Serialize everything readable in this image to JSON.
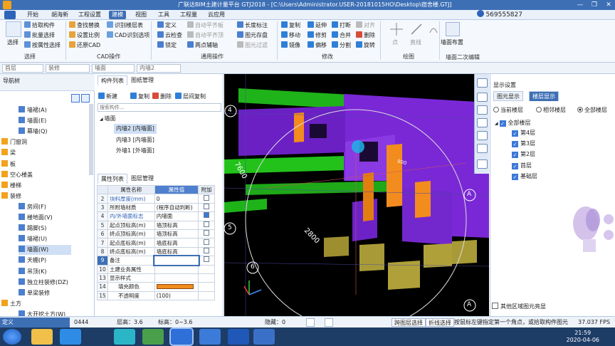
{
  "titlebar": {
    "title": "广联达BIM土建计量平台 GTJ2018 - [C:\\Users\\Administrator.USER-20181015HO\\Desktop\\宿舍楼.GTJ]"
  },
  "menubar": {
    "items": [
      "开始",
      "胡海新",
      "工程设置",
      "建模",
      "视图",
      "工具",
      "工程量",
      "云应用"
    ],
    "active": "建模",
    "user_id": "569555827"
  },
  "ribbon": {
    "select_label": "选择",
    "pick_component": "拾取构件",
    "batch_select": "批量选择",
    "select_by_attr": "按属性选择",
    "group_select": "选择",
    "find_replace": "查找替换",
    "set_scale": "设置比例",
    "restore_cad": "还原CAD",
    "identify_floor_table": "识别楼层表",
    "cad_identify_options": "CAD识别选项",
    "group_cad": "CAD操作",
    "define": "定义",
    "cloud_check": "云检查",
    "lock": "锁定",
    "auto_plane_slab": "自动平齐板",
    "auto_plane_top": "自动平齐顶",
    "two_point_axis": "两点辅轴",
    "find_element": "查找图元",
    "filter_element": "过滤图元",
    "length_mark": "长度标注",
    "element_save": "图元存盘",
    "element_filter": "图元过滤",
    "group_common": "通用操作",
    "copy": "复制",
    "move": "移动",
    "mirror": "镜像",
    "extend": "延伸",
    "trim": "修剪",
    "offset": "偏移",
    "break": "打断",
    "merge": "合并",
    "split": "分割",
    "delete": "删除",
    "rotate": "旋转",
    "align": "对齐",
    "group_modify": "修改",
    "draw_point": "点",
    "draw_line": "直线",
    "draw_arc": "",
    "group_draw": "绘图",
    "wall_layout": "墙面布置",
    "group_identify": "墙面二次编辑"
  },
  "selectors": {
    "floor": "首层",
    "type": "装修",
    "category": "墙面",
    "component": "内墙2"
  },
  "nav": {
    "title": "导航树",
    "items": [
      {
        "label": "墙裙(A)",
        "indent": 2
      },
      {
        "label": "墙面(E)",
        "indent": 2
      },
      {
        "label": "幕墙(Q)",
        "indent": 2
      },
      {
        "label": "门窗洞",
        "indent": 1
      },
      {
        "label": "梁",
        "indent": 1
      },
      {
        "label": "板",
        "indent": 1
      },
      {
        "label": "空心楼盖",
        "indent": 1
      },
      {
        "label": "楼梯",
        "indent": 1
      },
      {
        "label": "装修",
        "indent": 1
      },
      {
        "label": "房间(F)",
        "indent": 2
      },
      {
        "label": "楼地面(V)",
        "indent": 2
      },
      {
        "label": "踢脚(S)",
        "indent": 2
      },
      {
        "label": "墙裙(U)",
        "indent": 2
      },
      {
        "label": "墙面(W)",
        "indent": 2,
        "selected": true
      },
      {
        "label": "天棚(P)",
        "indent": 2
      },
      {
        "label": "吊顶(K)",
        "indent": 2
      },
      {
        "label": "独立柱装修(DZ)",
        "indent": 2
      },
      {
        "label": "单梁装修",
        "indent": 2
      },
      {
        "label": "土方",
        "indent": 1
      },
      {
        "label": "大开挖土方(W)",
        "indent": 2
      }
    ]
  },
  "components": {
    "tab1": "构件列表",
    "tab2": "图纸管理",
    "new_btn": "新建",
    "copy_btn": "复制",
    "delete_btn": "删除",
    "floor_copy_btn": "层间复制",
    "search_placeholder": "搜索构件...",
    "group": "墙面",
    "items": [
      "内墙2 [内墙面]",
      "内墙3 [内墙面]",
      "外墙1 [外墙面]"
    ]
  },
  "properties": {
    "tab1": "属性列表",
    "tab2": "图层管理",
    "headers": [
      "属性名称",
      "属性值",
      "附加"
    ],
    "rows": [
      {
        "n": "2",
        "name": "块料厚度(mm)",
        "value": "0",
        "cb": false,
        "blue": true
      },
      {
        "n": "3",
        "name": "所附墙材质",
        "value": "(程序自动判断)",
        "cb": false,
        "blue": false
      },
      {
        "n": "4",
        "name": "内/外墙面标志",
        "value": "内墙面",
        "cb": true,
        "blue": true
      },
      {
        "n": "5",
        "name": "起点顶标高(m)",
        "value": "墙顶标高",
        "cb": false,
        "blue": false
      },
      {
        "n": "6",
        "name": "终点顶标高(m)",
        "value": "墙顶标高",
        "cb": false,
        "blue": false
      },
      {
        "n": "7",
        "name": "起点底标高(m)",
        "value": "墙底标高",
        "cb": false,
        "blue": false
      },
      {
        "n": "8",
        "name": "终点底标高(m)",
        "value": "墙底标高",
        "cb": false,
        "blue": false
      },
      {
        "n": "9",
        "name": "备注",
        "value": "",
        "cb": false,
        "blue": false
      },
      {
        "n": "10",
        "name": "土建业务属性",
        "value": "",
        "cb": null,
        "blue": false
      },
      {
        "n": "13",
        "name": "显示样式",
        "value": "",
        "cb": null,
        "blue": false
      },
      {
        "n": "14",
        "name": "填充颜色",
        "value": "",
        "cb": null,
        "blue": false,
        "color": true
      },
      {
        "n": "15",
        "name": "不透明度",
        "value": "(100)",
        "cb": null,
        "blue": false
      }
    ]
  },
  "viewport": {
    "labels": [
      "4",
      "5",
      "6",
      "7600",
      "2800",
      "A",
      "A",
      "800"
    ]
  },
  "layers": {
    "title": "显示设置",
    "tab1": "图元显示",
    "tab2": "楼层显示",
    "radio1": "当前楼层",
    "radio2": "相邻楼层",
    "radio3": "全部楼层",
    "all": "全部楼层",
    "floors": [
      "第4层",
      "第3层",
      "第2层",
      "首层",
      "基础层"
    ],
    "bottom": "其他区域图元亮显"
  },
  "statusbar": {
    "define": "定义",
    "coord": "0444",
    "layer_height": "层高：3.6",
    "elev": "标高：0~3.6",
    "hidden": "隐藏：0",
    "cross_select": "跨图层选择",
    "fold_select": "折线选择",
    "hint": "按鼠标左键指定第一个角点，或拾取构件图元",
    "fps": "37.037 FPS"
  },
  "taskbar": {
    "time": "21:59",
    "date": "2020-04-06"
  },
  "colors": {
    "accent": "#3d6fb5",
    "wall_purple": "#7a28d6",
    "wall_green": "#22c21b",
    "wall_orange": "#f28c1e"
  }
}
